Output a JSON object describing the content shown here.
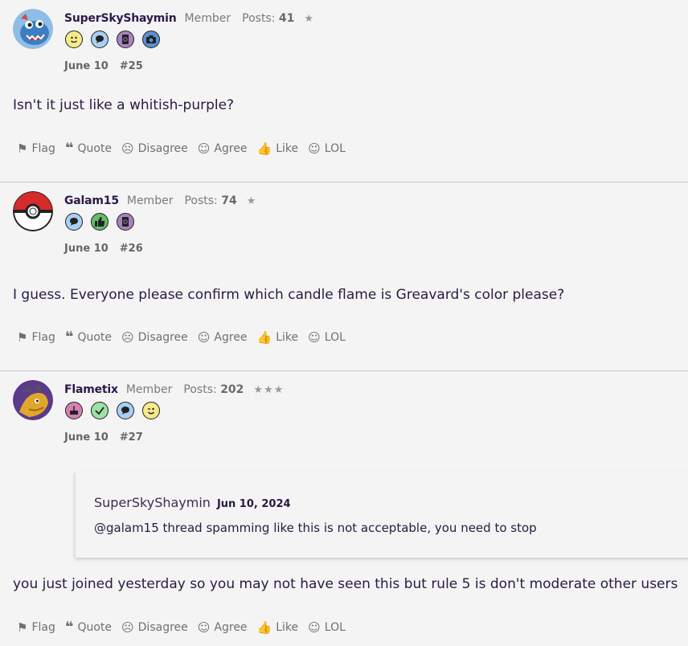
{
  "actions": {
    "flag": "Flag",
    "quote": "Quote",
    "disagree": "Disagree",
    "agree": "Agree",
    "like": "Like",
    "lol": "LOL"
  },
  "posts": [
    {
      "username": "SuperSkyShaymin",
      "role": "Member",
      "posts_label": "Posts:",
      "posts_count": "41",
      "stars": "★",
      "date": "June 10",
      "number": "#25",
      "text": "Isn't it just like a whitish-purple?",
      "badges": [
        "smiley-face-badge",
        "speech-bubble-badge",
        "address-book-badge",
        "camera-badge"
      ]
    },
    {
      "username": "Galam15",
      "role": "Member",
      "posts_label": "Posts:",
      "posts_count": "74",
      "stars": "★",
      "date": "June 10",
      "number": "#26",
      "text": "I guess. Everyone please confirm which candle flame is Greavard's color please?",
      "badges": [
        "speech-bubble-badge",
        "thumbs-up-badge",
        "address-book-badge"
      ]
    },
    {
      "username": "Flametix",
      "role": "Member",
      "posts_label": "Posts:",
      "posts_count": "202",
      "stars": "★★★",
      "date": "June 10",
      "number": "#27",
      "quote": {
        "author": "SuperSkyShaymin",
        "date": "Jun 10, 2024",
        "text": "@galam15 thread spamming like this is not acceptable, you need to stop"
      },
      "text": "you just joined yesterday so you may not have seen this but rule 5 is don't moderate other users",
      "badges": [
        "cake-badge",
        "checkmark-badge",
        "speech-bubble-badge",
        "winking-face-badge"
      ]
    }
  ]
}
